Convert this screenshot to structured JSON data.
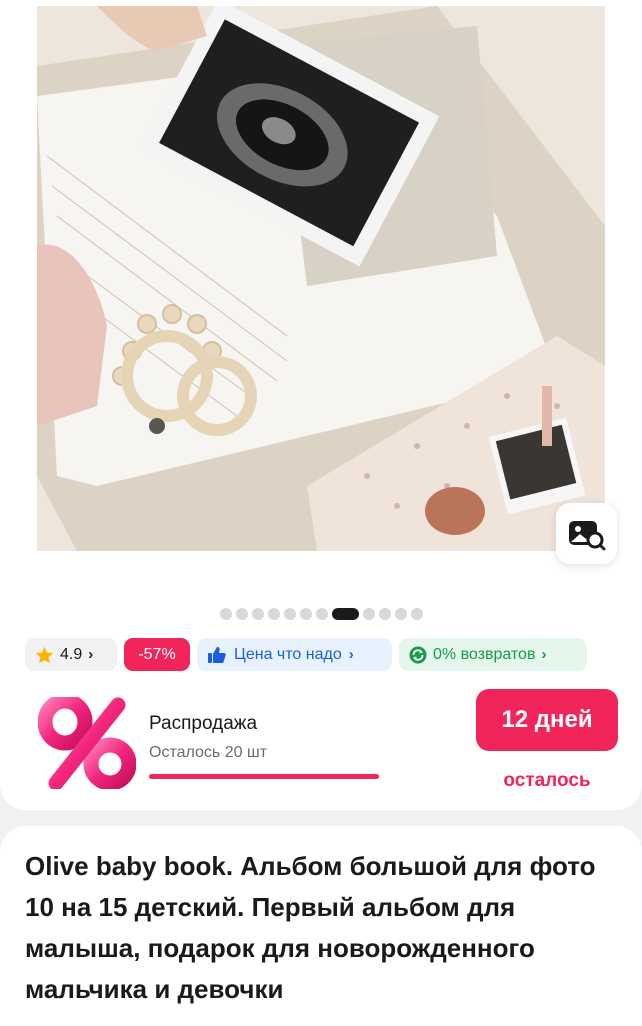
{
  "gallery": {
    "page_count": 12,
    "active_index": 7,
    "photo_alt": "Olive baby book"
  },
  "icons": {
    "visual_search": "image-search-icon",
    "rating": "star-icon",
    "price": "thumbs-up-icon",
    "returns": "return-cycle-icon",
    "sale": "percent-icon"
  },
  "badges": {
    "rating": "4.9",
    "discount": "-57%",
    "price_label": "Цена что надо",
    "returns_label": "0% возвратов"
  },
  "sale": {
    "title": "Распродажа",
    "remaining": "Осталось 20 шт",
    "progress": 1.0,
    "days": "12 дней",
    "days_caption": "осталось"
  },
  "product": {
    "title": "Olive baby book. Альбом большой для фото 10 на 15 детский. Первый альбом для малыша, подарок для новорожденного мальчика и девочки"
  },
  "colors": {
    "accent": "#f2255a",
    "price_blue": "#1a5fe0",
    "returns_green": "#1a9a46",
    "star": "#ffb300"
  }
}
